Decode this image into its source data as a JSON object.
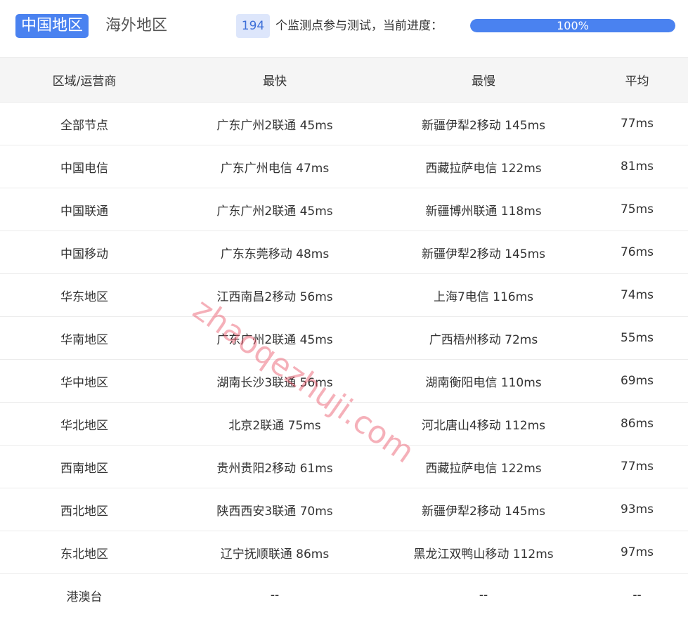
{
  "tabs": {
    "active": "中国地区",
    "inactive": "海外地区"
  },
  "status": {
    "count": "194",
    "text": "个监测点参与测试，当前进度：",
    "progress_label": "100%",
    "progress_value": 1.0
  },
  "colors": {
    "accent": "#4a82f0",
    "badge_bg": "#dde6fb",
    "watermark": "#e85064"
  },
  "table": {
    "headers": [
      "区域/运营商",
      "最快",
      "最慢",
      "平均"
    ],
    "rows": [
      [
        "全部节点",
        "广东广州2联通 45ms",
        "新疆伊犁2移动 145ms",
        "77ms"
      ],
      [
        "中国电信",
        "广东广州电信 47ms",
        "西藏拉萨电信 122ms",
        "81ms"
      ],
      [
        "中国联通",
        "广东广州2联通 45ms",
        "新疆博州联通 118ms",
        "75ms"
      ],
      [
        "中国移动",
        "广东东莞移动 48ms",
        "新疆伊犁2移动 145ms",
        "76ms"
      ],
      [
        "华东地区",
        "江西南昌2移动 56ms",
        "上海7电信 116ms",
        "74ms"
      ],
      [
        "华南地区",
        "广东广州2联通 45ms",
        "广西梧州移动 72ms",
        "55ms"
      ],
      [
        "华中地区",
        "湖南长沙3联通 56ms",
        "湖南衡阳电信 110ms",
        "69ms"
      ],
      [
        "华北地区",
        "北京2联通 75ms",
        "河北唐山4移动 112ms",
        "86ms"
      ],
      [
        "西南地区",
        "贵州贵阳2移动 61ms",
        "西藏拉萨电信 122ms",
        "77ms"
      ],
      [
        "西北地区",
        "陕西西安3联通 70ms",
        "新疆伊犁2移动 145ms",
        "93ms"
      ],
      [
        "东北地区",
        "辽宁抚顺联通 86ms",
        "黑龙江双鸭山移动 112ms",
        "97ms"
      ],
      [
        "港澳台",
        "--",
        "--",
        "--"
      ]
    ]
  },
  "watermark": "zhaoqezhuji.com"
}
